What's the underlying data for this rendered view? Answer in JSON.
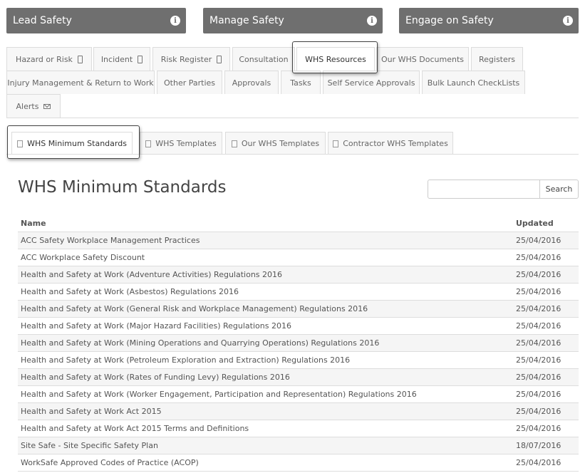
{
  "top_buttons": [
    {
      "label": "Lead Safety"
    },
    {
      "label": "Manage Safety"
    },
    {
      "label": "Engage on Safety"
    }
  ],
  "tabs": {
    "row1": [
      "Hazard or Risk",
      "Incident",
      "Risk Register",
      "Consultation",
      "WHS Resources",
      "Our WHS Documents",
      "Registers"
    ],
    "row2": [
      "Injury Management & Return to Work",
      "Other Parties",
      "Approvals",
      "Tasks",
      "Self Service Approvals",
      "Bulk Launch CheckLists"
    ],
    "row3": [
      "Alerts"
    ],
    "active": "WHS Resources"
  },
  "subtabs": [
    "WHS Minimum Standards",
    "WHS Templates",
    "Our WHS Templates",
    "Contractor WHS Templates"
  ],
  "page_title": "WHS Minimum Standards",
  "search": {
    "placeholder": "",
    "button_label": "Search"
  },
  "table": {
    "headers": {
      "name": "Name",
      "updated": "Updated"
    },
    "rows": [
      {
        "name": "ACC Safety Workplace Management Practices",
        "updated": "25/04/2016"
      },
      {
        "name": "ACC Workplace Safety Discount",
        "updated": "25/04/2016"
      },
      {
        "name": "Health and Safety at Work (Adventure Activities) Regulations 2016",
        "updated": "25/04/2016"
      },
      {
        "name": "Health and Safety at Work (Asbestos) Regulations 2016",
        "updated": "25/04/2016"
      },
      {
        "name": "Health and Safety at Work (General Risk and Workplace Management) Regulations 2016",
        "updated": "25/04/2016"
      },
      {
        "name": "Health and Safety at Work (Major Hazard Facilities) Regulations 2016",
        "updated": "25/04/2016"
      },
      {
        "name": "Health and Safety at Work (Mining Operations and Quarrying Operations) Regulations 2016",
        "updated": "25/04/2016"
      },
      {
        "name": "Health and Safety at Work (Petroleum Exploration and Extraction) Regulations 2016",
        "updated": "25/04/2016"
      },
      {
        "name": "Health and Safety at Work (Rates of Funding Levy) Regulations 2016",
        "updated": "25/04/2016"
      },
      {
        "name": "Health and Safety at Work (Worker Engagement, Participation and Representation) Regulations 2016",
        "updated": "25/04/2016"
      },
      {
        "name": "Health and Safety at Work Act 2015",
        "updated": "25/04/2016"
      },
      {
        "name": "Health and Safety at Work Act 2015 Terms and Definitions",
        "updated": "25/04/2016"
      },
      {
        "name": "Site Safe - Site Specific Safety Plan",
        "updated": "18/07/2016"
      },
      {
        "name": "WorkSafe Approved Codes of Practice (ACOP)",
        "updated": "25/04/2016"
      }
    ]
  }
}
